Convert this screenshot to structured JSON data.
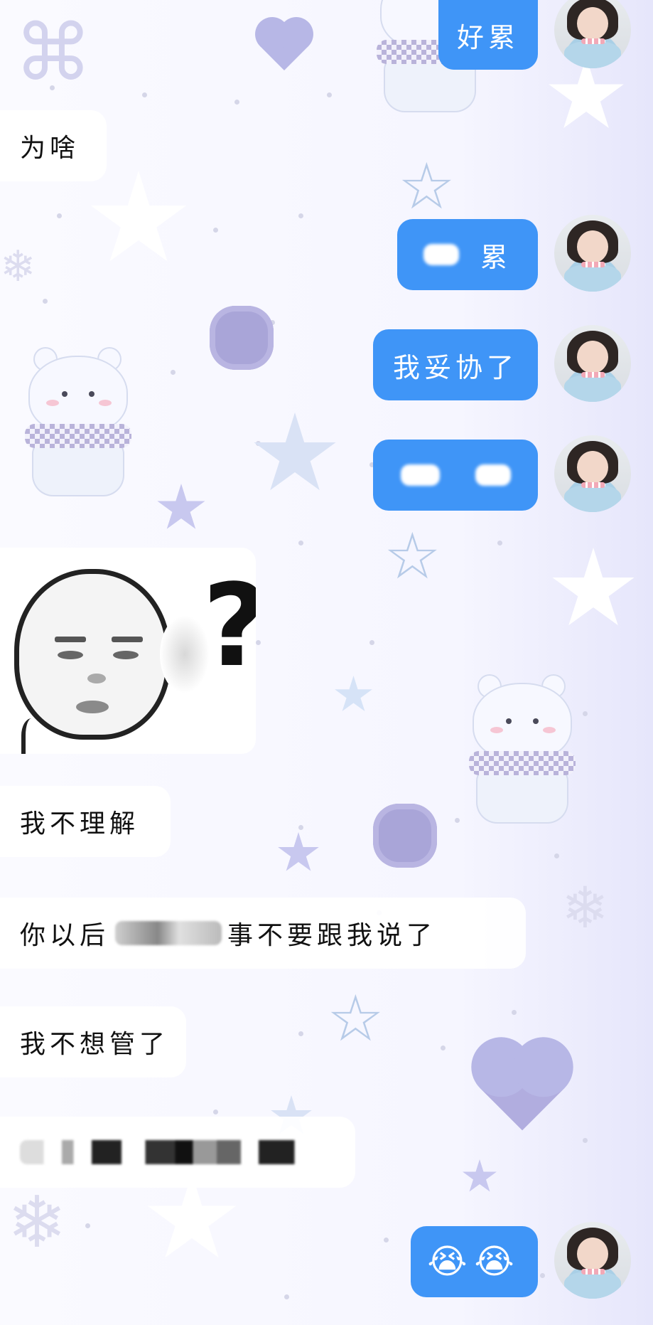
{
  "messages": [
    {
      "id": "m1",
      "side": "out",
      "text": "好累"
    },
    {
      "id": "m2",
      "side": "in",
      "text": "为啥"
    },
    {
      "id": "m3",
      "side": "out",
      "text": "累",
      "redacted_prefix": true
    },
    {
      "id": "m4",
      "side": "out",
      "text": "我妥协了"
    },
    {
      "id": "m5",
      "side": "out",
      "text": "",
      "redacted": true
    },
    {
      "id": "m6",
      "side": "in",
      "type": "sticker",
      "sticker": "confused-face-question-mark"
    },
    {
      "id": "m7",
      "side": "in",
      "text": "我不理解"
    },
    {
      "id": "m8",
      "side": "in",
      "text_before": "你以后",
      "text_after": "事不要跟我说了",
      "redacted_middle": true
    },
    {
      "id": "m9",
      "side": "in",
      "text": "我不想管了"
    },
    {
      "id": "m10",
      "side": "in",
      "text": "",
      "redacted": true
    },
    {
      "id": "m11",
      "side": "out",
      "text": "😭😭",
      "type": "emoji"
    }
  ],
  "colors": {
    "outgoing_bubble": "#3f95f7",
    "incoming_bubble": "#ffffff",
    "background": "#f6f6ff"
  },
  "avatar": {
    "icon": "user-avatar-girl-photo"
  }
}
